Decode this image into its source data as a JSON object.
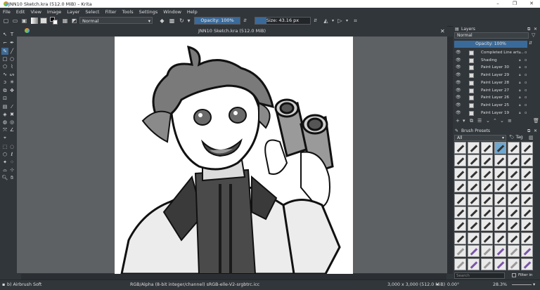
{
  "window": {
    "title": "JNN10 Sketch.kra (512.0 MiB)  – Krita",
    "minimize": "–",
    "maximize": "❐",
    "close": "✕"
  },
  "menu": [
    "File",
    "Edit",
    "View",
    "Image",
    "Layer",
    "Select",
    "Filter",
    "Tools",
    "Settings",
    "Window",
    "Help"
  ],
  "toolbar": {
    "blend_mode": "Normal",
    "opacity": "Opacity: 100%",
    "opacity_fraction": 1.0,
    "size": "Size: 43.16 px",
    "size_fraction": 0.2
  },
  "document": {
    "title": "JNN10 Sketch.kra (512.0 MiB)",
    "close": "✕"
  },
  "layers_panel": {
    "header": "Layers",
    "blend_mode": "Normal",
    "opacity": "Opacity: 100%",
    "layers": [
      {
        "name": "Completed Line art ...",
        "selected": false
      },
      {
        "name": "Shading",
        "selected": false
      },
      {
        "name": "Paint Layer 30",
        "selected": false
      },
      {
        "name": "Paint Layer 29",
        "selected": false
      },
      {
        "name": "Paint Layer 28",
        "selected": false
      },
      {
        "name": "Paint Layer 27",
        "selected": false
      },
      {
        "name": "Paint Layer 26",
        "selected": false
      },
      {
        "name": "Paint Layer 25",
        "selected": false
      },
      {
        "name": "Paint Layer 19",
        "selected": false
      }
    ]
  },
  "brush_panel": {
    "header": "Brush Presets",
    "filter_value": "All",
    "tag_label": "Tag",
    "search_placeholder": "Search",
    "filter_in_tag": "Filter in Tag"
  },
  "status": {
    "brush": "b) Airbrush Soft",
    "color_space": "RGB/Alpha (8-bit integer/channel)  sRGB-elle-V2-srgbtrc.icc",
    "image_size": "3,000 x 3,000 (512.0 MiB)",
    "rotation": "0.00°",
    "zoom": "28.3%"
  }
}
